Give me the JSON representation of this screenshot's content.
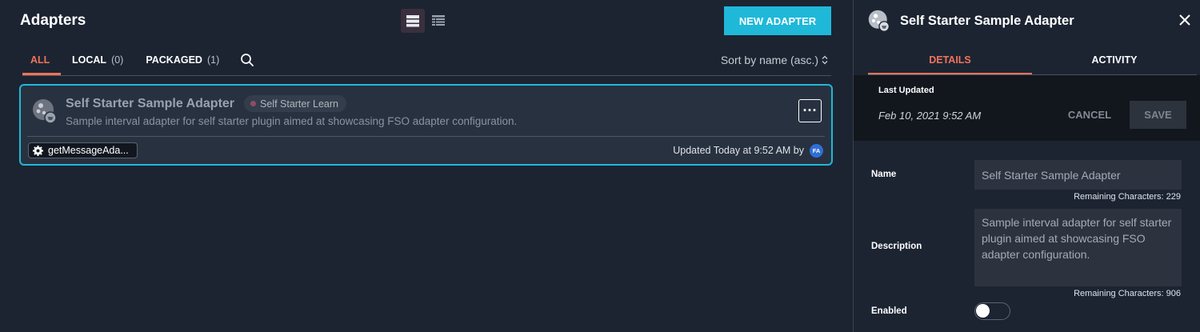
{
  "header": {
    "title": "Adapters",
    "new_button": "NEW ADAPTER"
  },
  "view_toggle": {
    "active": "list",
    "options": [
      "list-icon",
      "grid-icon"
    ]
  },
  "tabs": [
    {
      "label": "ALL",
      "count": "",
      "active": true
    },
    {
      "label": "LOCAL",
      "count": "(0)",
      "active": false
    },
    {
      "label": "PACKAGED",
      "count": "(1)",
      "active": false
    }
  ],
  "sort": {
    "label": "Sort by name (asc.)"
  },
  "card": {
    "title": "Self Starter Sample Adapter",
    "tag": "Self Starter Learn",
    "description": "Sample interval adapter for self starter plugin aimed at showcasing FSO adapter configuration.",
    "chip": "getMessageAda...",
    "updated": "Updated Today at 9:52 AM by",
    "avatar": "FA",
    "more": "···"
  },
  "panel": {
    "title": "Self Starter Sample Adapter",
    "tabs": [
      "DETAILS",
      "ACTIVITY"
    ],
    "last_updated_label": "Last Updated",
    "last_updated_value": "Feb 10, 2021 9:52 AM",
    "cancel": "CANCEL",
    "save": "SAVE",
    "name_label": "Name",
    "name_value": "Self Starter Sample Adapter",
    "name_remaining": "Remaining Characters: 229",
    "description_label": "Description",
    "description_value": "Sample interval adapter for self starter plugin aimed at showcasing FSO adapter configuration.",
    "description_remaining": "Remaining Characters: 906",
    "enabled_label": "Enabled",
    "enabled": false
  },
  "colors": {
    "accent": "#1fb8d9",
    "active_tab": "#f0735a",
    "background": "#1c2432"
  }
}
